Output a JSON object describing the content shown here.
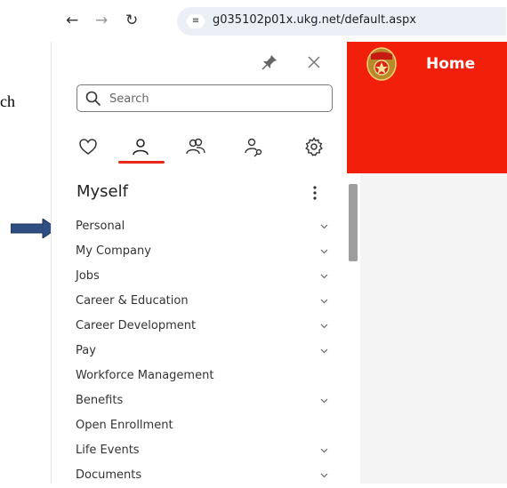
{
  "document": {
    "fragment": "ch"
  },
  "browser": {
    "url": "g035102p01x.ukg.net/default.aspx"
  },
  "sidebar": {
    "search_placeholder": "Search",
    "section_title": "Myself",
    "tabs": [
      {
        "icon": "heart-icon"
      },
      {
        "icon": "person-icon",
        "active": true
      },
      {
        "icon": "people-icon"
      },
      {
        "icon": "person-key-icon"
      },
      {
        "icon": "gear-icon"
      }
    ],
    "items": [
      {
        "label": "Personal",
        "expandable": true
      },
      {
        "label": "My Company",
        "expandable": true
      },
      {
        "label": "Jobs",
        "expandable": true
      },
      {
        "label": "Career & Education",
        "expandable": true
      },
      {
        "label": "Career Development",
        "expandable": true
      },
      {
        "label": "Pay",
        "expandable": true
      },
      {
        "label": "Workforce Management",
        "expandable": false
      },
      {
        "label": "Benefits",
        "expandable": true
      },
      {
        "label": "Open Enrollment",
        "expandable": false
      },
      {
        "label": "Life Events",
        "expandable": true
      },
      {
        "label": "Documents",
        "expandable": true
      }
    ]
  },
  "header": {
    "title": "Home"
  },
  "colors": {
    "brand": "#f2200a",
    "active_tab": "#e8281a",
    "arrow": "#2f4f82"
  }
}
